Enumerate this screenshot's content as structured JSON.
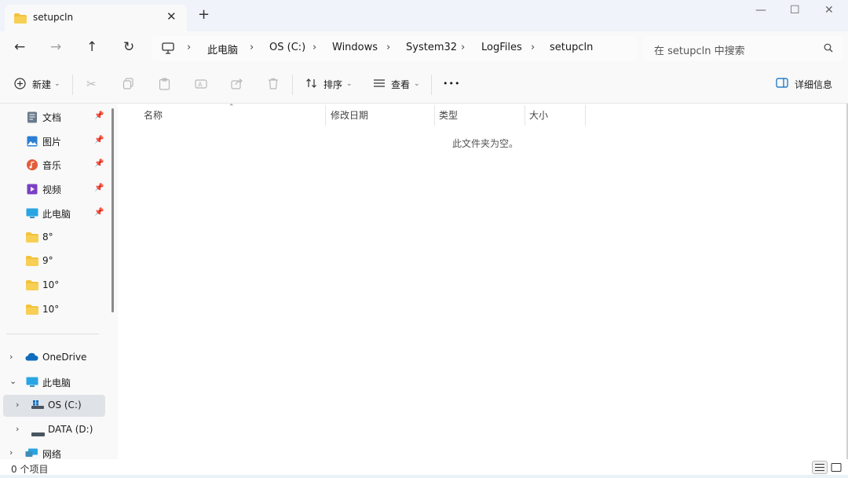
{
  "tab": {
    "title": "setupcln",
    "close": "✕",
    "new_tab": "+"
  },
  "window_controls": {
    "minimize": "—",
    "maximize": "☐",
    "close": "✕"
  },
  "nav": {
    "back": "←",
    "forward": "→",
    "up": "↑",
    "refresh": "↻"
  },
  "breadcrumb": [
    "此电脑",
    "OS (C:)",
    "Windows",
    "System32",
    "LogFiles",
    "setupcln"
  ],
  "breadcrumb_sep": "›",
  "search": {
    "placeholder": "在 setupcln 中搜索"
  },
  "commands": {
    "new_label": "新建",
    "sort_label": "排序",
    "view_label": "查看",
    "more": "•••",
    "details_label": "详细信息",
    "icons": [
      "cut-icon",
      "copy-icon",
      "paste-icon",
      "rename-icon",
      "share-icon",
      "delete-icon"
    ]
  },
  "sidebar": {
    "quick": [
      {
        "label": "文档",
        "icon": "documents-icon",
        "pinned": true
      },
      {
        "label": "图片",
        "icon": "pictures-icon",
        "pinned": true
      },
      {
        "label": "音乐",
        "icon": "music-icon",
        "pinned": true
      },
      {
        "label": "视频",
        "icon": "videos-icon",
        "pinned": true
      },
      {
        "label": "此电脑",
        "icon": "computer-icon",
        "pinned": true
      },
      {
        "label": "8°",
        "icon": "folder-icon",
        "pinned": false
      },
      {
        "label": "9°",
        "icon": "folder-icon",
        "pinned": false
      },
      {
        "label": "10°",
        "icon": "folder-icon",
        "pinned": false
      },
      {
        "label": "10°",
        "icon": "folder-icon",
        "pinned": false
      }
    ],
    "tree": [
      {
        "label": "OneDrive",
        "icon": "cloud-icon",
        "expanded": false
      },
      {
        "label": "此电脑",
        "icon": "computer-icon",
        "expanded": true
      },
      {
        "label": "OS (C:)",
        "icon": "drive-c-icon",
        "expanded": false,
        "selected": true
      },
      {
        "label": "DATA (D:)",
        "icon": "drive-icon",
        "expanded": false
      },
      {
        "label": "网络",
        "icon": "network-icon",
        "expanded": false
      }
    ]
  },
  "columns": [
    "名称",
    "修改日期",
    "类型",
    "大小"
  ],
  "empty_message": "此文件夹为空。",
  "status": {
    "item_count": "0 个项目"
  },
  "colors": {
    "folder": "#f3c23c",
    "accent": "#0067c0"
  }
}
